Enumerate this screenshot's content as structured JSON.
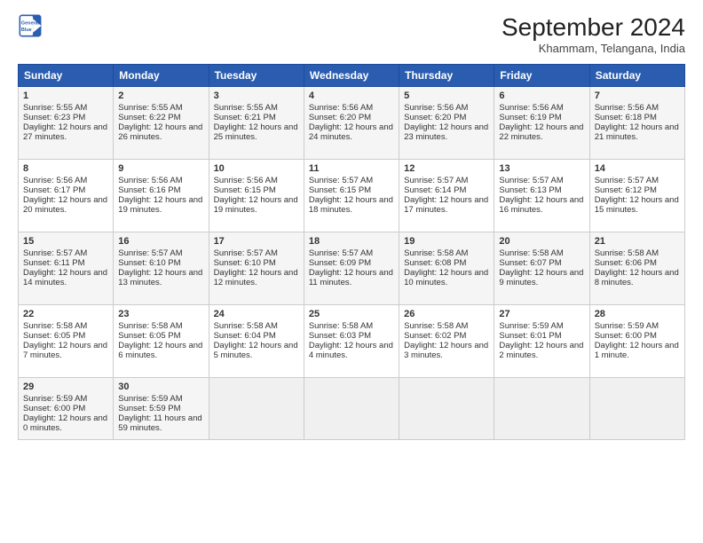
{
  "logo": {
    "line1": "General",
    "line2": "Blue"
  },
  "title": "September 2024",
  "location": "Khammam, Telangana, India",
  "days_of_week": [
    "Sunday",
    "Monday",
    "Tuesday",
    "Wednesday",
    "Thursday",
    "Friday",
    "Saturday"
  ],
  "weeks": [
    [
      {
        "day": "1",
        "sunrise": "Sunrise: 5:55 AM",
        "sunset": "Sunset: 6:23 PM",
        "daylight": "Daylight: 12 hours and 27 minutes."
      },
      {
        "day": "2",
        "sunrise": "Sunrise: 5:55 AM",
        "sunset": "Sunset: 6:22 PM",
        "daylight": "Daylight: 12 hours and 26 minutes."
      },
      {
        "day": "3",
        "sunrise": "Sunrise: 5:55 AM",
        "sunset": "Sunset: 6:21 PM",
        "daylight": "Daylight: 12 hours and 25 minutes."
      },
      {
        "day": "4",
        "sunrise": "Sunrise: 5:56 AM",
        "sunset": "Sunset: 6:20 PM",
        "daylight": "Daylight: 12 hours and 24 minutes."
      },
      {
        "day": "5",
        "sunrise": "Sunrise: 5:56 AM",
        "sunset": "Sunset: 6:20 PM",
        "daylight": "Daylight: 12 hours and 23 minutes."
      },
      {
        "day": "6",
        "sunrise": "Sunrise: 5:56 AM",
        "sunset": "Sunset: 6:19 PM",
        "daylight": "Daylight: 12 hours and 22 minutes."
      },
      {
        "day": "7",
        "sunrise": "Sunrise: 5:56 AM",
        "sunset": "Sunset: 6:18 PM",
        "daylight": "Daylight: 12 hours and 21 minutes."
      }
    ],
    [
      {
        "day": "8",
        "sunrise": "Sunrise: 5:56 AM",
        "sunset": "Sunset: 6:17 PM",
        "daylight": "Daylight: 12 hours and 20 minutes."
      },
      {
        "day": "9",
        "sunrise": "Sunrise: 5:56 AM",
        "sunset": "Sunset: 6:16 PM",
        "daylight": "Daylight: 12 hours and 19 minutes."
      },
      {
        "day": "10",
        "sunrise": "Sunrise: 5:56 AM",
        "sunset": "Sunset: 6:15 PM",
        "daylight": "Daylight: 12 hours and 19 minutes."
      },
      {
        "day": "11",
        "sunrise": "Sunrise: 5:57 AM",
        "sunset": "Sunset: 6:15 PM",
        "daylight": "Daylight: 12 hours and 18 minutes."
      },
      {
        "day": "12",
        "sunrise": "Sunrise: 5:57 AM",
        "sunset": "Sunset: 6:14 PM",
        "daylight": "Daylight: 12 hours and 17 minutes."
      },
      {
        "day": "13",
        "sunrise": "Sunrise: 5:57 AM",
        "sunset": "Sunset: 6:13 PM",
        "daylight": "Daylight: 12 hours and 16 minutes."
      },
      {
        "day": "14",
        "sunrise": "Sunrise: 5:57 AM",
        "sunset": "Sunset: 6:12 PM",
        "daylight": "Daylight: 12 hours and 15 minutes."
      }
    ],
    [
      {
        "day": "15",
        "sunrise": "Sunrise: 5:57 AM",
        "sunset": "Sunset: 6:11 PM",
        "daylight": "Daylight: 12 hours and 14 minutes."
      },
      {
        "day": "16",
        "sunrise": "Sunrise: 5:57 AM",
        "sunset": "Sunset: 6:10 PM",
        "daylight": "Daylight: 12 hours and 13 minutes."
      },
      {
        "day": "17",
        "sunrise": "Sunrise: 5:57 AM",
        "sunset": "Sunset: 6:10 PM",
        "daylight": "Daylight: 12 hours and 12 minutes."
      },
      {
        "day": "18",
        "sunrise": "Sunrise: 5:57 AM",
        "sunset": "Sunset: 6:09 PM",
        "daylight": "Daylight: 12 hours and 11 minutes."
      },
      {
        "day": "19",
        "sunrise": "Sunrise: 5:58 AM",
        "sunset": "Sunset: 6:08 PM",
        "daylight": "Daylight: 12 hours and 10 minutes."
      },
      {
        "day": "20",
        "sunrise": "Sunrise: 5:58 AM",
        "sunset": "Sunset: 6:07 PM",
        "daylight": "Daylight: 12 hours and 9 minutes."
      },
      {
        "day": "21",
        "sunrise": "Sunrise: 5:58 AM",
        "sunset": "Sunset: 6:06 PM",
        "daylight": "Daylight: 12 hours and 8 minutes."
      }
    ],
    [
      {
        "day": "22",
        "sunrise": "Sunrise: 5:58 AM",
        "sunset": "Sunset: 6:05 PM",
        "daylight": "Daylight: 12 hours and 7 minutes."
      },
      {
        "day": "23",
        "sunrise": "Sunrise: 5:58 AM",
        "sunset": "Sunset: 6:05 PM",
        "daylight": "Daylight: 12 hours and 6 minutes."
      },
      {
        "day": "24",
        "sunrise": "Sunrise: 5:58 AM",
        "sunset": "Sunset: 6:04 PM",
        "daylight": "Daylight: 12 hours and 5 minutes."
      },
      {
        "day": "25",
        "sunrise": "Sunrise: 5:58 AM",
        "sunset": "Sunset: 6:03 PM",
        "daylight": "Daylight: 12 hours and 4 minutes."
      },
      {
        "day": "26",
        "sunrise": "Sunrise: 5:58 AM",
        "sunset": "Sunset: 6:02 PM",
        "daylight": "Daylight: 12 hours and 3 minutes."
      },
      {
        "day": "27",
        "sunrise": "Sunrise: 5:59 AM",
        "sunset": "Sunset: 6:01 PM",
        "daylight": "Daylight: 12 hours and 2 minutes."
      },
      {
        "day": "28",
        "sunrise": "Sunrise: 5:59 AM",
        "sunset": "Sunset: 6:00 PM",
        "daylight": "Daylight: 12 hours and 1 minute."
      }
    ],
    [
      {
        "day": "29",
        "sunrise": "Sunrise: 5:59 AM",
        "sunset": "Sunset: 6:00 PM",
        "daylight": "Daylight: 12 hours and 0 minutes."
      },
      {
        "day": "30",
        "sunrise": "Sunrise: 5:59 AM",
        "sunset": "Sunset: 5:59 PM",
        "daylight": "Daylight: 11 hours and 59 minutes."
      },
      null,
      null,
      null,
      null,
      null
    ]
  ]
}
